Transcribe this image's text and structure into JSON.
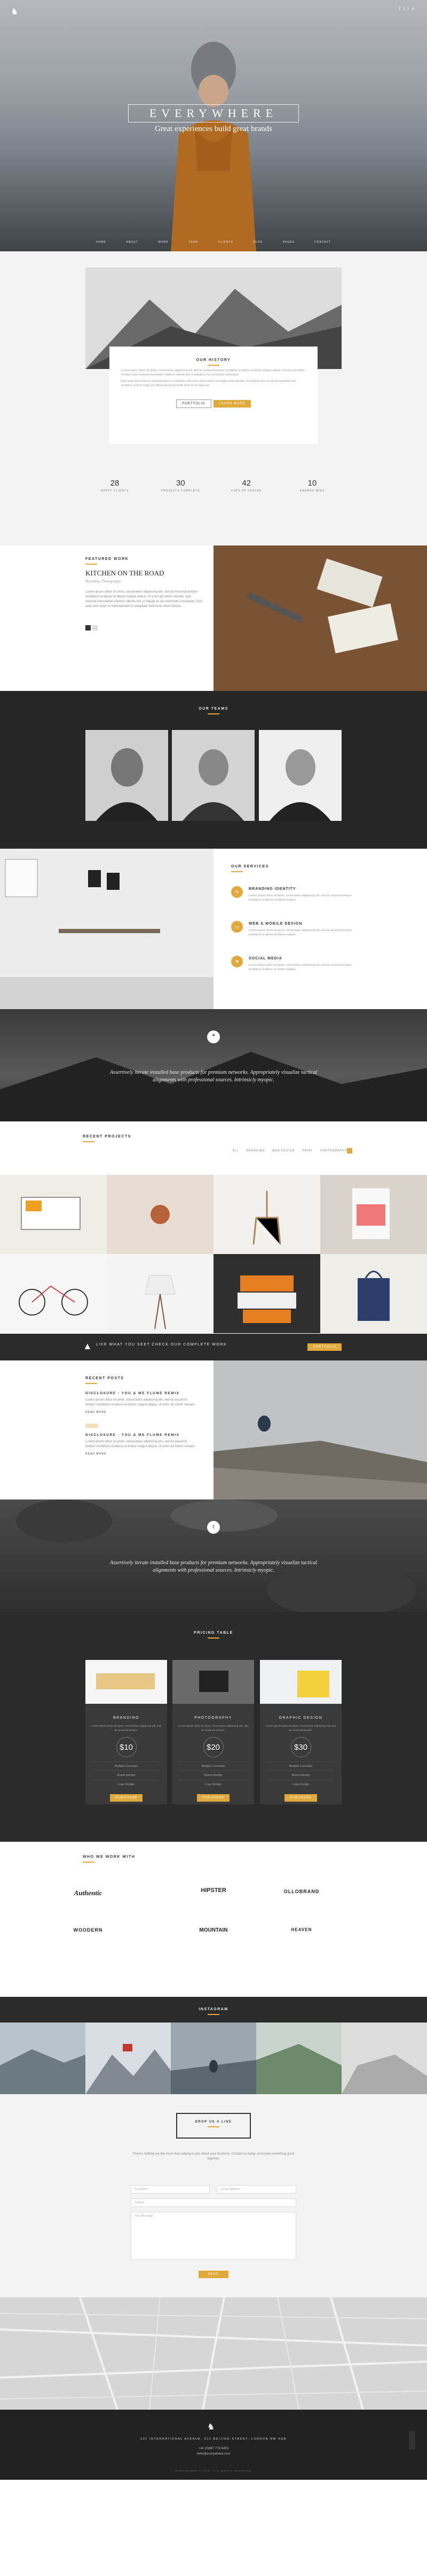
{
  "hero": {
    "title": "EVERYWHERE",
    "subtitle": "Great experiences build great brands",
    "nav": [
      "HOME",
      "ABOUT",
      "WORK",
      "TEAM",
      "CLIENTS",
      "BLOG",
      "PAGES",
      "CONTACT"
    ],
    "social": [
      "f",
      "t",
      "in"
    ]
  },
  "story": {
    "heading": "OUR HISTORY",
    "body": [
      "Lorem ipsum dolor sit amet, consectetur adipiscing elit, sed do eiusmod tempor incididunt ut labore et dolore magna aliqua. Ut enim ad minim veniam, quis nostrud exercitation ullamco laboris nisi ut aliquip ex ea commodo consequat.",
      "Duis aute irure dolor in reprehenderit in voluptate velit esse cillum dolore eu fugiat nulla pariatur. Excepteur sint occaecat cupidatat non proident, sunt in culpa qui officia deserunt mollit anim id est laborum."
    ],
    "btn1": "PORTFOLIO",
    "btn2": "LEARN MORE",
    "stats": [
      {
        "n": "28",
        "l": "HAPPY CLIENTS"
      },
      {
        "n": "30",
        "l": "PROJECTS COMPLETE"
      },
      {
        "n": "42",
        "l": "CUPS OF COFFEE"
      },
      {
        "n": "10",
        "l": "AWARDS WINS"
      }
    ]
  },
  "featured": {
    "label": "FEATURED WORK",
    "title": "KITCHEN ON THE ROAD",
    "subtitle": "Branding, Photography",
    "body": "Lorem ipsum dolor sit amet, consectetur adipiscing elit, sed do eiusmod tempor incididunt ut labore et dolore magna aliqua. Ut enim ad minim veniam, quis nostrud exercitation ullamco laboris nisi ut aliquip ex ea commodo consequat. Duis aute irure dolor in reprehenderit in voluptate velit esse cillum dolore."
  },
  "team": {
    "heading": "OUR TEAMS"
  },
  "services": {
    "heading": "OUR SERVICES",
    "items": [
      {
        "title": "BRANDING IDENTITY",
        "desc": "Lorem ipsum dolor sit amet, consectetur adipiscing elit, sed do eiusmod tempor incididunt ut labore et dolore magna."
      },
      {
        "title": "WEB & MOBILE DESIGN",
        "desc": "Lorem ipsum dolor sit amet, consectetur adipiscing elit, sed do eiusmod tempor incididunt ut labore et dolore magna."
      },
      {
        "title": "SOCIAL MEDIA",
        "desc": "Lorem ipsum dolor sit amet, consectetur adipiscing elit, sed do eiusmod tempor incididunt ut labore et dolore magna."
      }
    ]
  },
  "quote1": {
    "text": "Assertively iterate installed base products for premium networks. Appropriately visualize tactical alignments with professional sources. Intrinsicly myopic."
  },
  "portfolio": {
    "heading": "RECENT PROJECTS",
    "filters": [
      "ALL",
      "BRANDING",
      "WEB DESIGN",
      "PRINT",
      "PHOTOGRAPHY"
    ]
  },
  "cta": {
    "text": "LIKE WHAT YOU SEE? CHECK OUR COMPLETE WORK",
    "btn": "PORTFOLIO"
  },
  "blog": {
    "heading": "RECENT POSTS",
    "posts": [
      {
        "title": "DISCLOSURE - YOU & ME FLUME REMIX",
        "body": "Lorem ipsum dolor sit amet, consectetur adipiscing elit, sed do eiusmod tempor incididunt ut labore et dolore magna aliqua. Ut enim ad minim veniam.",
        "more": "READ MORE"
      },
      {
        "title": "DISCLOSURE - YOU & ME FLUME REMIX",
        "body": "Lorem ipsum dolor sit amet, consectetur adipiscing elit, sed do eiusmod tempor incididunt ut labore et dolore magna aliqua. Ut enim ad minim veniam.",
        "more": "READ MORE"
      }
    ]
  },
  "quote2": {
    "text": "Assertively iterate installed base products for premium networks. Appropriately visualize tactical alignments with professional sources. Intrinsicly myopic."
  },
  "pricing": {
    "heading": "PRICING TABLE",
    "plans": [
      {
        "title": "BRANDING",
        "price": "$10",
        "features": [
          "Multiple Concepts",
          "Brand Identity",
          "Logo Design"
        ],
        "btn": "PURCHASE",
        "desc": "Lorem ipsum dolor sit amet, consectetur adipiscing elit, sed do eiusmod tempor."
      },
      {
        "title": "PHOTOGRAPHY",
        "price": "$20",
        "features": [
          "Multiple Concepts",
          "Brand Identity",
          "Logo Design"
        ],
        "btn": "PURCHASE",
        "desc": "Lorem ipsum dolor sit amet, consectetur adipiscing elit, sed do eiusmod tempor."
      },
      {
        "title": "GRAPHIC DESIGN",
        "price": "$30",
        "features": [
          "Multiple Concepts",
          "Brand Identity",
          "Logo Design"
        ],
        "btn": "PURCHASE",
        "desc": "Lorem ipsum dolor sit amet, consectetur adipiscing elit, sed do eiusmod tempor."
      }
    ]
  },
  "clients": {
    "heading": "WHO WE WORK WITH",
    "logos": [
      "Authentic",
      "HIPSTER",
      "OLLOBRAND",
      "WOODERN",
      "MOUNTAIN",
      "HEAVEN"
    ]
  },
  "instagram": {
    "heading": "INSTAGRAM"
  },
  "contact": {
    "box": "DROP US A LINE",
    "body": "There's nothing we like more than talking to you about your business. Contact us today and make something great together.",
    "name": "Full Name",
    "email": "Email Address",
    "subject": "Subject",
    "message": "Your Message",
    "btn": "SEND"
  },
  "footer": {
    "address": "231 INTERNATIONAL AVENUE, 512 BEIJING STREET, LONDON NW 4QB",
    "phone": "+41 (0)987 776 6453",
    "email": "hello@everywhere.com",
    "copyright": "EVERYWHERE © 2015 • ALL RIGHTS RESERVED"
  }
}
